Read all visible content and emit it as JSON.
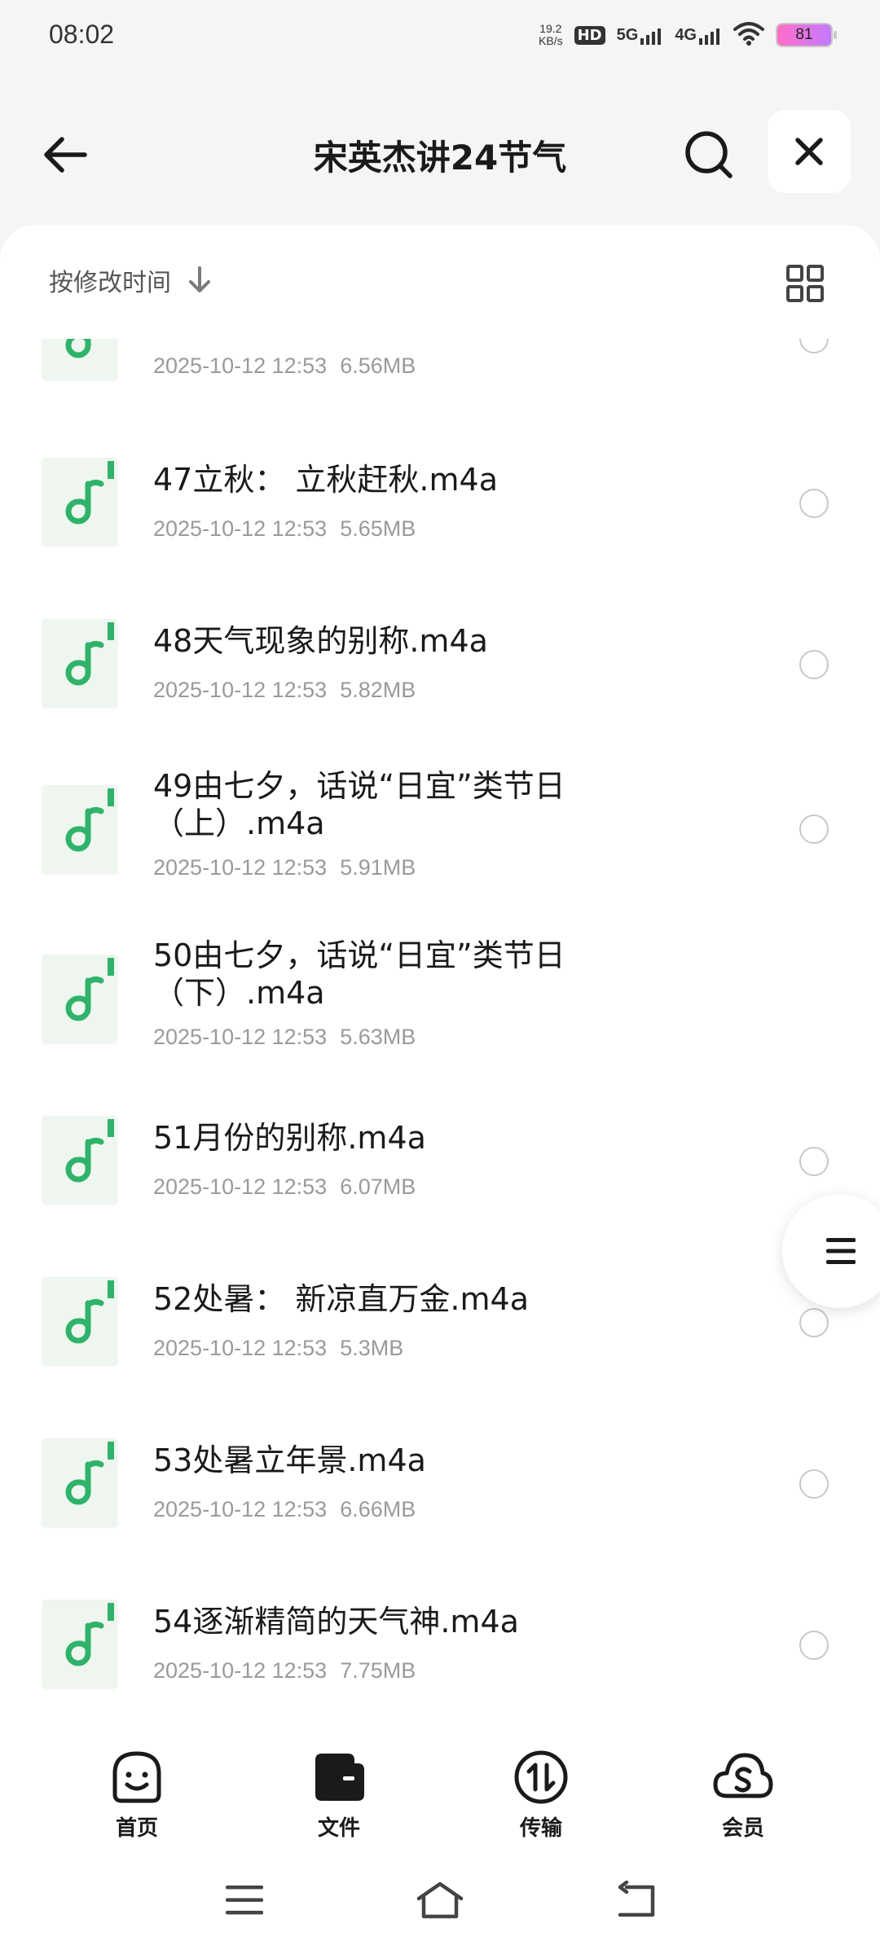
{
  "status_bar": {
    "time": "08:02",
    "net_speed_value": "19.2",
    "net_speed_unit": "KB/s",
    "hd_label": "HD",
    "signal1_label": "5G",
    "signal2_label": "4G",
    "battery": "81"
  },
  "header": {
    "title": "宋英杰讲24节气",
    "back_icon": "arrow-left-icon",
    "search_icon": "search-icon",
    "close_icon": "close-icon"
  },
  "sort_bar": {
    "label": "按修改时间",
    "arrow_icon": "arrow-down-icon",
    "view_icon": "grid-view-icon"
  },
  "files": [
    {
      "name": "",
      "date": "2025-10-12 12:53",
      "size": "6.56MB"
    },
    {
      "name": "47立秋： 立秋赶秋.m4a",
      "date": "2025-10-12 12:53",
      "size": "5.65MB"
    },
    {
      "name": "48天气现象的别称.m4a",
      "date": "2025-10-12 12:53",
      "size": "5.82MB"
    },
    {
      "name": "49由七夕，话说“日宜”类节日（上）.m4a",
      "date": "2025-10-12 12:53",
      "size": "5.91MB"
    },
    {
      "name": "50由七夕，话说“日宜”类节日（下）.m4a",
      "date": "2025-10-12 12:53",
      "size": "5.63MB"
    },
    {
      "name": "51月份的别称.m4a",
      "date": "2025-10-12 12:53",
      "size": "6.07MB"
    },
    {
      "name": "52处暑： 新凉直万金.m4a",
      "date": "2025-10-12 12:53",
      "size": "5.3MB"
    },
    {
      "name": "53处暑立年景.m4a",
      "date": "2025-10-12 12:53",
      "size": "6.66MB"
    },
    {
      "name": "54逐渐精简的天气神.m4a",
      "date": "2025-10-12 12:53",
      "size": "7.75MB"
    }
  ],
  "bottom_nav": {
    "home": "首页",
    "files": "文件",
    "transfer": "传输",
    "member": "会员"
  },
  "colors": {
    "accent_green": "#2fb36a",
    "thumb_bg": "#eef6ef"
  }
}
